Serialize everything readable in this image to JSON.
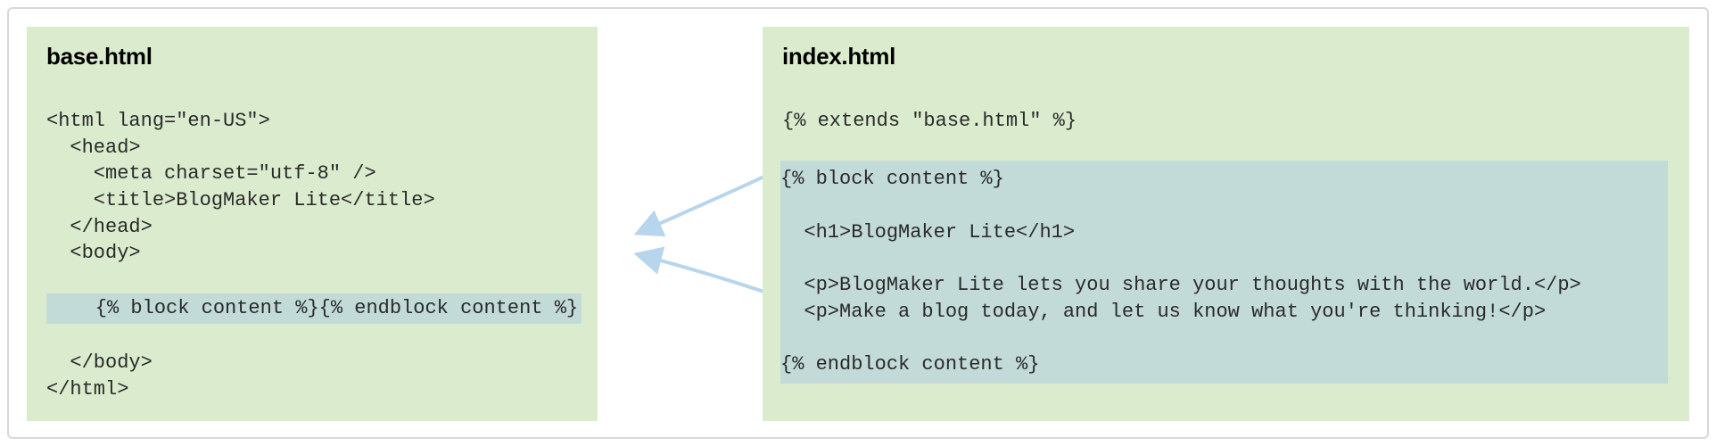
{
  "left": {
    "filename": "base.html",
    "code_before": "<html lang=\"en-US\">\n  <head>\n    <meta charset=\"utf-8\" />\n    <title>BlogMaker Lite</title>\n  </head>\n  <body>\n",
    "highlight_line": "    {% block content %}{% endblock content %}",
    "code_after": "\n  </body>\n</html>"
  },
  "right": {
    "filename": "index.html",
    "extends_line": "{% extends \"base.html\" %}",
    "block_open": "{% block content %}",
    "block_inner": "\n  <h1>BlogMaker Lite</h1>\n\n  <p>BlogMaker Lite lets you share your thoughts with the world.</p>\n  <p>Make a blog today, and let us know what you're thinking!</p>\n",
    "block_close": "{% endblock content %}"
  }
}
